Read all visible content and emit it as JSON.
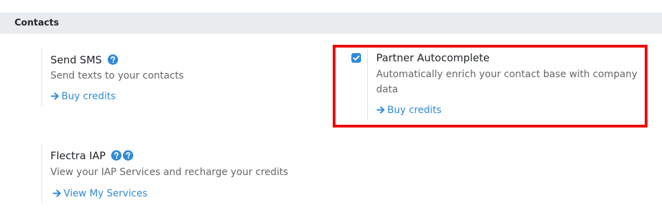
{
  "section": {
    "title": "Contacts"
  },
  "settings": {
    "send_sms": {
      "title": "Send SMS",
      "description": "Send texts to your contacts",
      "link": "Buy credits"
    },
    "partner_autocomplete": {
      "title": "Partner Autocomplete",
      "checked": true,
      "description_line1": "Automatically enrich your contact base with company",
      "description_line2": "data",
      "link": "Buy credits"
    },
    "flectra_iap": {
      "title": "Flectra IAP",
      "description": "View your IAP Services and recharge your credits",
      "link": "View My Services"
    }
  },
  "colors": {
    "accent": "#2e8bd8",
    "section_bg": "#e9ecef",
    "highlight_border": "#ee0000"
  },
  "icons": {
    "help": "question-circle-icon",
    "arrow": "arrow-right-icon",
    "checkbox": "checkmark-icon"
  }
}
